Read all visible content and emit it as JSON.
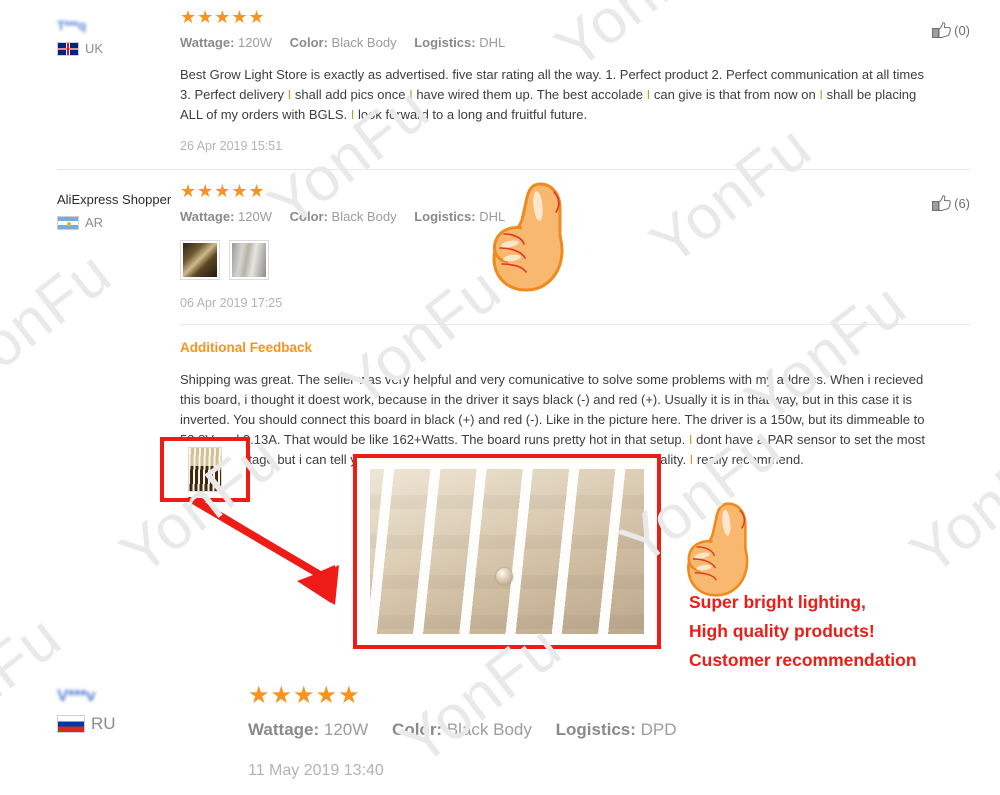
{
  "watermark": {
    "text": "YonFu",
    "color": "#e9e9e9"
  },
  "theme": {
    "star_color": "#f7941e",
    "accent_orange": "#f7941e",
    "highlight_letter_color": "#c99a2e",
    "promo_red": "#ee1b16",
    "divider_color": "#e8e8e8"
  },
  "labels": {
    "wattage_key": "Wattage:",
    "color_key": "Color:",
    "logistics_key": "Logistics:",
    "additional_feedback": "Additional Feedback",
    "stars": "★★★★★"
  },
  "reviews": [
    {
      "name": "T***q",
      "name_masked": true,
      "country_code": "UK",
      "flag": "flag-uk-icon",
      "rating": 5,
      "wattage": "120W",
      "color": "Black Body",
      "logistics": "DHL",
      "like_count": "(0)",
      "date": "26 Apr 2019 15:51",
      "text_lines": [
        "Best Grow Light Store is exactly as advertised. five star rating all the way. 1. Perfect product 2. Perfect communication at all times",
        "3. Perfect delivery I shall add pics once I have wired them up. The best accolade I can give is that from now on I shall be placing",
        "ALL of my orders with BGLS. I look forward to a long and fruitful future."
      ]
    },
    {
      "name": "AliExpress Shopper",
      "name_masked": false,
      "country_code": "AR",
      "flag": "flag-ar-icon",
      "rating": 5,
      "wattage": "120W",
      "color": "Black Body",
      "logistics": "DHL",
      "like_count": "(6)",
      "date": "06 Apr 2019 17:25",
      "thumbnail_count": 2,
      "additional_feedback_lines": [
        "Shipping was great. The seller was very helpful and very comunicative to solve some problems with my address. When i recieved",
        "this board, i thought it doest work, because in the driver it says black (-) and red (+). Usually it is in that way, but in this case it is",
        "inverted. You should connect this board in black (+) and red (-). Like in the picture here. The driver is a 150w, but its dimmeable to",
        "52.8V and 3.13A. That would be like 162+Watts. The board runs pretty hot in that setup. I dont have a PAR sensor to set the most",
        "efficient wattage but i can tell you, this is very bright. Everything else seems high quality. I really recommend."
      ]
    },
    {
      "name": "V***v",
      "name_masked": true,
      "country_code": "RU",
      "flag": "flag-ru-icon",
      "rating": 5,
      "wattage": "120W",
      "color": "Black Body",
      "logistics": "DPD",
      "date": "11 May 2019 13:40"
    }
  ],
  "promo": {
    "lines": [
      "Super bright lighting,",
      "High quality products!",
      "Customer recommendation"
    ],
    "arrow_name": "red-arrow-annotation",
    "hand_name": "thumbs-up-illustration"
  }
}
